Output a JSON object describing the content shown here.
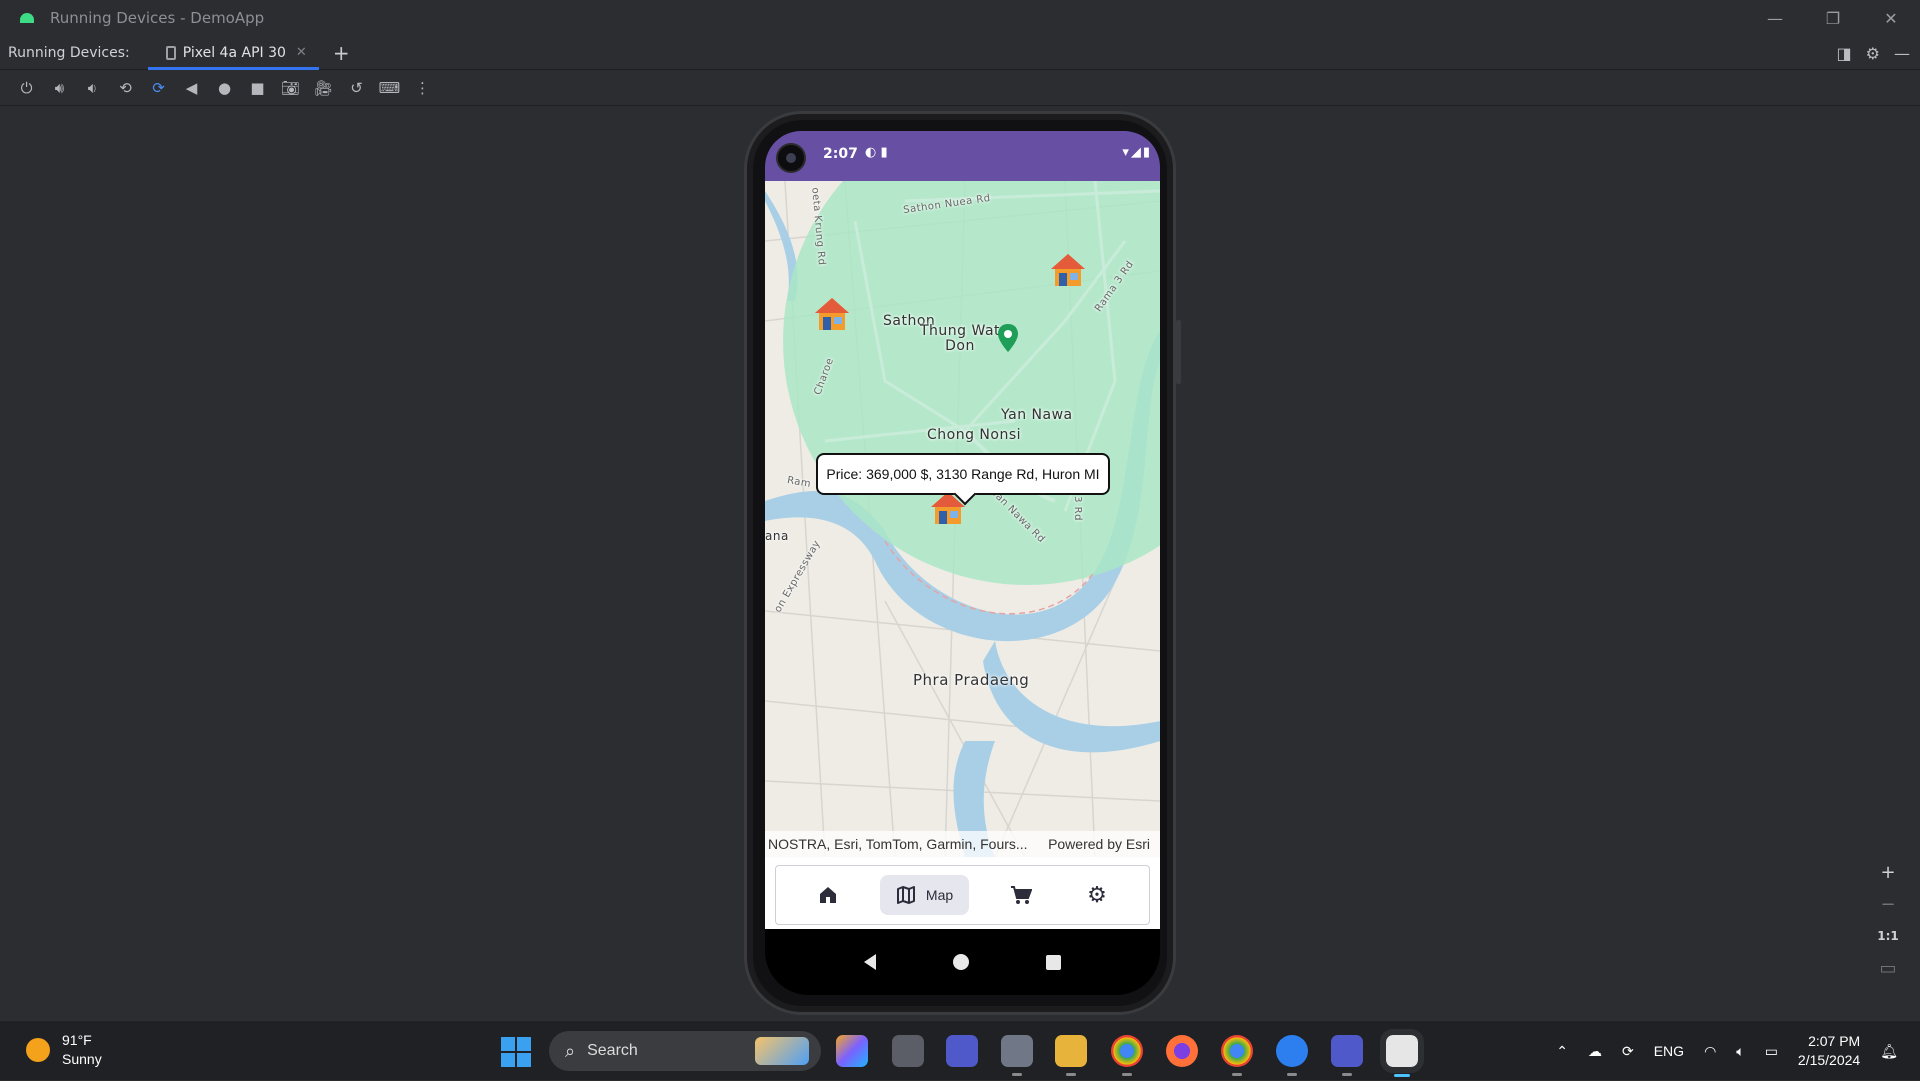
{
  "window": {
    "title": "Running Devices - DemoApp",
    "controls": [
      "minimize",
      "restore",
      "close"
    ]
  },
  "running_devices": {
    "label": "Running Devices:",
    "tab_label": "Pixel 4a API 30",
    "add_tab": "+"
  },
  "toolbar": {
    "buttons": [
      "power",
      "volume-up",
      "volume-down",
      "rotate-left",
      "rotate-right",
      "back",
      "home",
      "overview",
      "screenshot",
      "screen-record",
      "reset",
      "keyboard",
      "more"
    ]
  },
  "device": {
    "status_time": "2:07"
  },
  "map": {
    "places": {
      "sathon": "Sathon",
      "thung_wat_don": "Thung Wat\nDon",
      "yan_nawa": "Yan Nawa",
      "chong_nonsi": "Chong Nonsi",
      "phra_pradaeng": "Phra Pradaeng",
      "ana": "ana"
    },
    "roads": {
      "sathon_nuea": "Sathon Nuea Rd",
      "rama3": "Rama 3 Rd",
      "expressway": "on Expressway",
      "yan_nawa_rd": "Yan Nawa Rd",
      "ram": "Ram",
      "rd3": "3 Rd",
      "charoen": "Charoe",
      "krung": "oeta Krung Rd"
    },
    "callout_text": "Price: 369,000 $, 3130 Range Rd, Huron MI",
    "attribution": "NOSTRA, Esri, TomTom, Garmin, Fours...",
    "powered_by": "Powered by Esri",
    "colors": {
      "buffer_fill": "#a8e6c4",
      "water": "#a9cfe6",
      "land": "#efece6",
      "pin": "#1e9e56"
    }
  },
  "app_nav": {
    "items": [
      {
        "name": "home",
        "label": ""
      },
      {
        "name": "map",
        "label": "Map"
      },
      {
        "name": "cart",
        "label": ""
      },
      {
        "name": "settings",
        "label": ""
      }
    ]
  },
  "zoom_tools": {
    "plus": "+",
    "minus": "−",
    "actual": "1:1"
  },
  "taskbar": {
    "weather_temp": "91°F",
    "weather_desc": "Sunny",
    "search_placeholder": "Search",
    "language": "ENG",
    "time": "2:07 PM",
    "date": "2/15/2024"
  }
}
